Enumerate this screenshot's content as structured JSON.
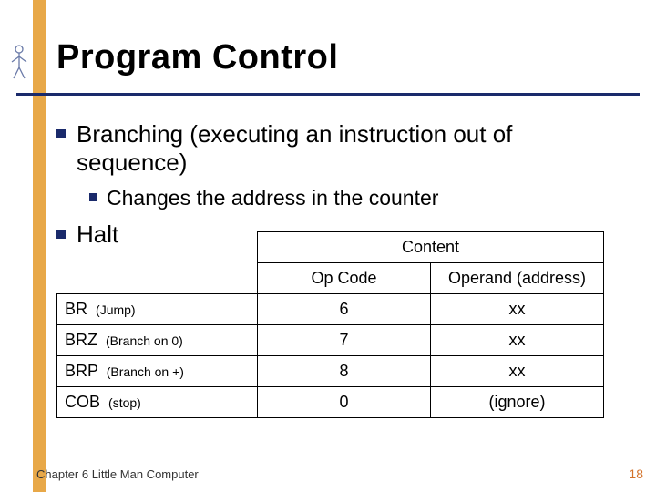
{
  "title": "Program Control",
  "bullets": {
    "b1_branching": "Branching (executing an instruction out of sequence)",
    "b2_changes": "Changes the address in the counter",
    "b1_halt": "Halt"
  },
  "table": {
    "content_header": "Content",
    "col_opcode": "Op Code",
    "col_operand": "Operand (address)",
    "rows": [
      {
        "mn": "BR",
        "desc": "(Jump)",
        "op": "6",
        "addr": "xx"
      },
      {
        "mn": "BRZ",
        "desc": "(Branch on 0)",
        "op": "7",
        "addr": "xx"
      },
      {
        "mn": "BRP",
        "desc": "(Branch on +)",
        "op": "8",
        "addr": "xx"
      },
      {
        "mn": "COB",
        "desc": "(stop)",
        "op": "0",
        "addr": "(ignore)"
      }
    ]
  },
  "footer": "Chapter 6 Little Man Computer",
  "page": "18"
}
